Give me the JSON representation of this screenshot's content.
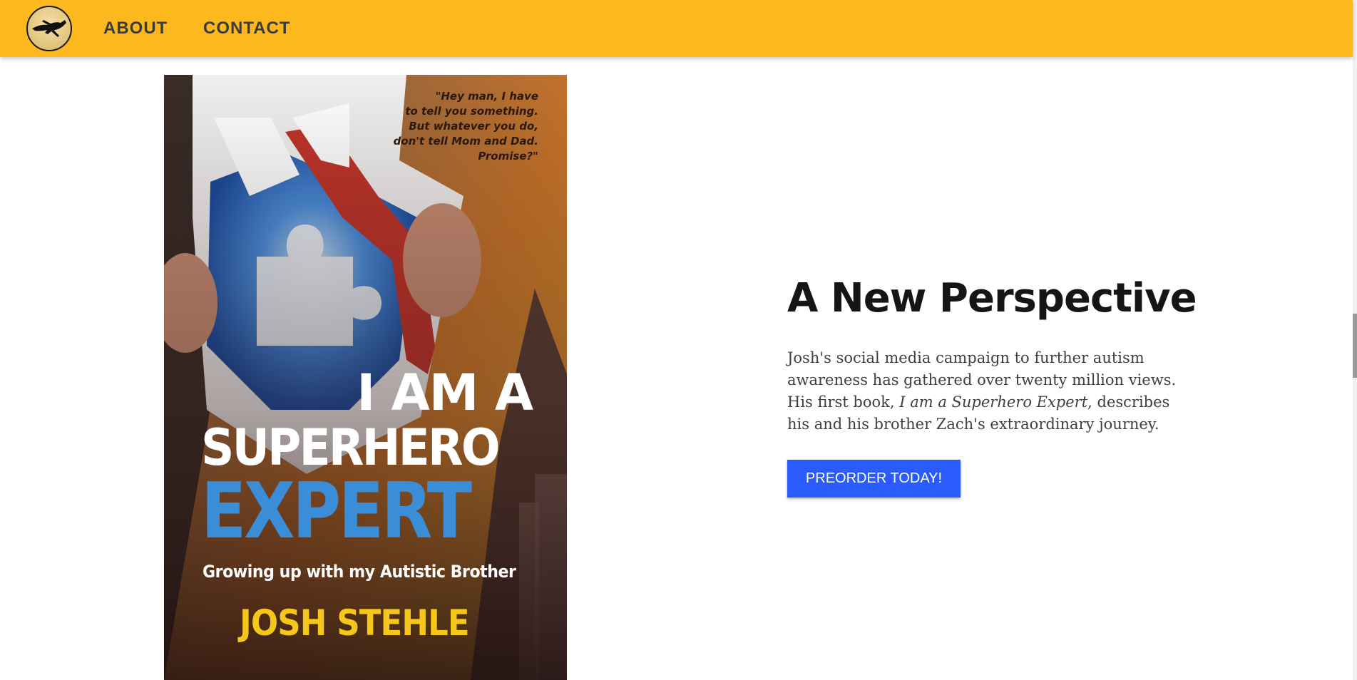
{
  "nav": {
    "about_label": "ABOUT",
    "contact_label": "CONTACT",
    "logo_icon": "running-dog-logo-icon"
  },
  "book_cover": {
    "quote_lines": [
      "\"Hey man, I have",
      "to tell you something.",
      "But whatever you do,",
      "don't tell Mom and Dad.",
      "Promise?\""
    ],
    "title_line1": "I AM A",
    "title_line2": "SUPERHERO",
    "title_line3": "EXPERT",
    "subtitle": "Growing up with my Autistic Brother",
    "author": "JOSH STEHLE",
    "puzzle_icon": "puzzle-piece-icon"
  },
  "hero": {
    "heading": "A New Perspective",
    "body_before": "Josh's social media campaign to further autism awareness has gathered over twenty million views. His first book, ",
    "body_title": "I am a Superhero Expert",
    "body_after": ", describes his and his brother Zach's extraordinary journey.",
    "cta_label": "PREORDER TODAY!"
  },
  "colors": {
    "nav_bg": "#fdb81e",
    "cta_bg": "#2a5bff",
    "expert_blue": "#3a8ed8",
    "author_yellow": "#f5c71a"
  }
}
